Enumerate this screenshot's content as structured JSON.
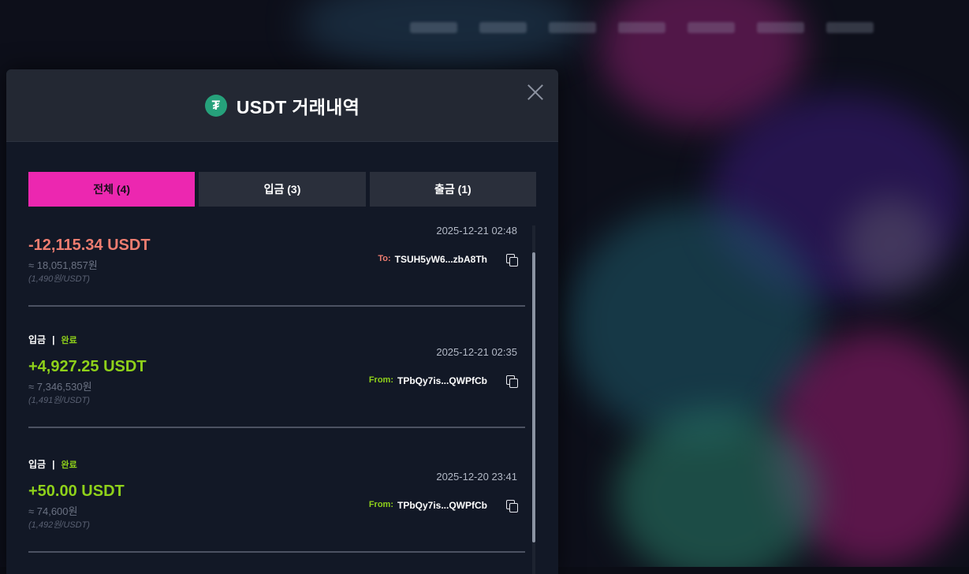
{
  "modal": {
    "title": "USDT 거래내역",
    "logo_glyph": "₮",
    "accent_color": "#ec27b0",
    "tabs": [
      {
        "label": "전체 (4)",
        "active": true
      },
      {
        "label": "입금 (3)",
        "active": false
      },
      {
        "label": "출금 (1)",
        "active": false
      }
    ],
    "transactions": [
      {
        "type_label": "",
        "status": "",
        "date": "2025-12-21 02:48",
        "amount": "-12,115.34 USDT",
        "krw": "≈ 18,051,857원",
        "rate": "(1,490원/USDT)",
        "direction_label": "To:",
        "address": "TSUH5yW6...zbA8Th"
      },
      {
        "type_label": "입금",
        "separator": "|",
        "status": "완료",
        "date": "2025-12-21 02:35",
        "amount": "+4,927.25 USDT",
        "krw": "≈ 7,346,530원",
        "rate": "(1,491원/USDT)",
        "direction_label": "From:",
        "address": "TPbQy7is...QWPfCb"
      },
      {
        "type_label": "입금",
        "separator": "|",
        "status": "완료",
        "date": "2025-12-20 23:41",
        "amount": "+50.00 USDT",
        "krw": "≈ 74,600원",
        "rate": "(1,492원/USDT)",
        "direction_label": "From:",
        "address": "TPbQy7is...QWPfCb"
      }
    ]
  }
}
